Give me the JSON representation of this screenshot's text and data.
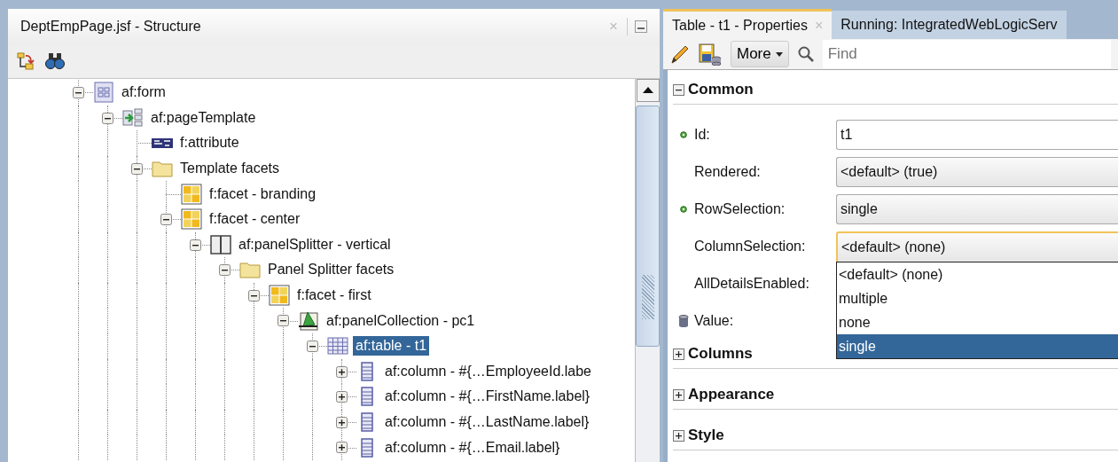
{
  "structure_panel": {
    "title": "DeptEmpPage.jsf - Structure",
    "close": "×",
    "tree": [
      {
        "label": "af:form",
        "kind": "form",
        "expanded": true,
        "selected": false,
        "children": [
          {
            "label": "af:pageTemplate",
            "kind": "template",
            "expanded": true,
            "selected": false,
            "children": [
              {
                "label": "f:attribute",
                "kind": "attribute",
                "selected": false
              },
              {
                "label": "Template facets",
                "kind": "folder",
                "expanded": true,
                "selected": false,
                "children": [
                  {
                    "label": "f:facet - branding",
                    "kind": "facet",
                    "selected": false
                  },
                  {
                    "label": "f:facet - center",
                    "kind": "facet",
                    "expanded": true,
                    "selected": false,
                    "children": [
                      {
                        "label": "af:panelSplitter - vertical",
                        "kind": "splitter",
                        "expanded": true,
                        "selected": false,
                        "children": [
                          {
                            "label": "Panel Splitter facets",
                            "kind": "folder",
                            "expanded": true,
                            "selected": false,
                            "children": [
                              {
                                "label": "f:facet - first",
                                "kind": "facet",
                                "expanded": true,
                                "selected": false,
                                "children": [
                                  {
                                    "label": "af:panelCollection - pc1",
                                    "kind": "collection",
                                    "expanded": true,
                                    "selected": false,
                                    "children": [
                                      {
                                        "label": "af:table - t1",
                                        "kind": "table",
                                        "expanded": true,
                                        "selected": true,
                                        "children": [
                                          {
                                            "label": "af:column - #{…EmployeeId.labe",
                                            "kind": "column",
                                            "expanded": false,
                                            "selected": false
                                          },
                                          {
                                            "label": "af:column - #{…FirstName.label}",
                                            "kind": "column",
                                            "expanded": false,
                                            "selected": false
                                          },
                                          {
                                            "label": "af:column - #{…LastName.label}",
                                            "kind": "column",
                                            "expanded": false,
                                            "selected": false
                                          },
                                          {
                                            "label": "af:column - #{…Email.label}",
                                            "kind": "column",
                                            "expanded": false,
                                            "selected": false
                                          }
                                        ]
                                      }
                                    ]
                                  }
                                ]
                              }
                            ]
                          }
                        ]
                      }
                    ]
                  }
                ]
              }
            ]
          }
        ]
      }
    ]
  },
  "properties_panel": {
    "tabs": [
      {
        "label": "Table - t1 - Properties",
        "close": "×",
        "selected": true
      },
      {
        "label": "Running: IntegratedWebLogicServ",
        "selected": false
      }
    ],
    "toolbar": {
      "more": "More",
      "search": {
        "placeholder": "Find"
      }
    },
    "sections": [
      {
        "title": "Common",
        "expanded": true,
        "properties": [
          {
            "label": "Id:",
            "kind": "set",
            "field": {
              "kind": "text",
              "value": "t1",
              "focused": false
            }
          },
          {
            "label": "Rendered:",
            "kind": "plain",
            "field": {
              "kind": "select",
              "value": "<default> (true)",
              "focused": false
            }
          },
          {
            "label": "RowSelection:",
            "kind": "set",
            "field": {
              "kind": "select",
              "value": "single",
              "focused": false
            }
          },
          {
            "label": "ColumnSelection:",
            "kind": "plain",
            "field": {
              "kind": "select",
              "value": "<default> (none)",
              "focused": true
            },
            "options": [
              {
                "label": "<default> (none)",
                "selected": false
              },
              {
                "label": "multiple",
                "selected": false
              },
              {
                "label": "none",
                "selected": false
              },
              {
                "label": "single",
                "selected": true
              }
            ]
          },
          {
            "label": "AllDetailsEnabled:",
            "kind": "plain"
          },
          {
            "label": "Value:",
            "kind": "bound"
          }
        ]
      },
      {
        "title": "Columns",
        "expanded": false
      },
      {
        "title": "Appearance",
        "expanded": false
      },
      {
        "title": "Style",
        "expanded": false
      }
    ]
  }
}
